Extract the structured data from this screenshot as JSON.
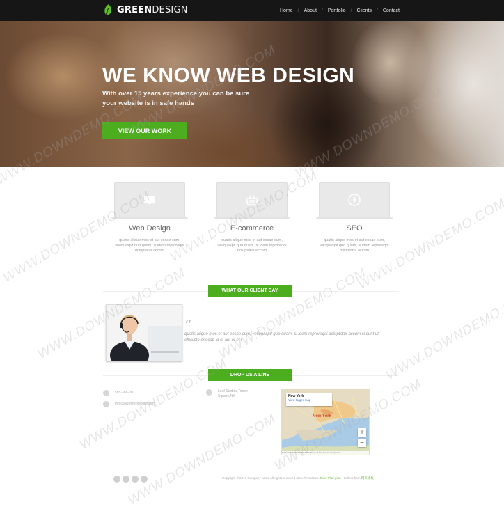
{
  "header": {
    "logo": {
      "bold": "GREEN",
      "thin": "DESIGN"
    },
    "nav": [
      {
        "label": "Home"
      },
      {
        "label": "About"
      },
      {
        "label": "Portfolio"
      },
      {
        "label": "Clients"
      },
      {
        "label": "Contact"
      }
    ]
  },
  "hero": {
    "title": "WE KNOW WEB DESIGN",
    "subtitle_line1": "With over 15 years experience you can be sure",
    "subtitle_line2": "your website is in safe hands",
    "button": "VIEW OUR WORK"
  },
  "features": [
    {
      "title": "Web Design",
      "text": "quatis alique mos et aut eccae cum, veliquaspit quo quam, si idem reproreqoi doluptatur accum",
      "icon": "monitor-icon"
    },
    {
      "title": "E-commerce",
      "text": "quatis alique mos et aut eccae cum, veliquaspit quo quam, si idem reproreqoi doluptatur accum",
      "icon": "basket-icon"
    },
    {
      "title": "SEO",
      "text": "quatis alique mos et aut eccae cum, veliquaspit quo quam, si idem reproreqoi doluptatur accum",
      "icon": "compass-icon"
    }
  ],
  "testimonial": {
    "heading": "WHAT OUR CLIENT SAY",
    "quote_mark": "“",
    "text": "quatis alique mos et aut eccae cum, veliquaspit quo quam, si idem reproreqoi doluptatur accum si sunt ut officiisto enecab id et aut et et l"
  },
  "contact": {
    "heading": "DROP US A LINE",
    "phone": "555-388-001",
    "email": "Infocal@greendesign.com",
    "address_line1": "Leaf Studios,Times",
    "address_line2": "Square,NY"
  },
  "map": {
    "place": "New York",
    "link": "View larger map",
    "city_label": "New York",
    "zoom_in": "+",
    "zoom_out": "−",
    "footer": "Keyboard shortcuts   Map Data   Terms of Use   Report a map error"
  },
  "footer": {
    "copyright": "Copyright © 2016 Company name All rights reserved",
    "credit": "More Templates",
    "credit_link": "Zhiyu Plan plan",
    "collect": "- Collect from",
    "collect_link": "网页模板"
  },
  "watermark": "WWW.DOWNDEMO.COM",
  "colors": {
    "accent": "#4cae1e",
    "topbar": "#161616"
  }
}
